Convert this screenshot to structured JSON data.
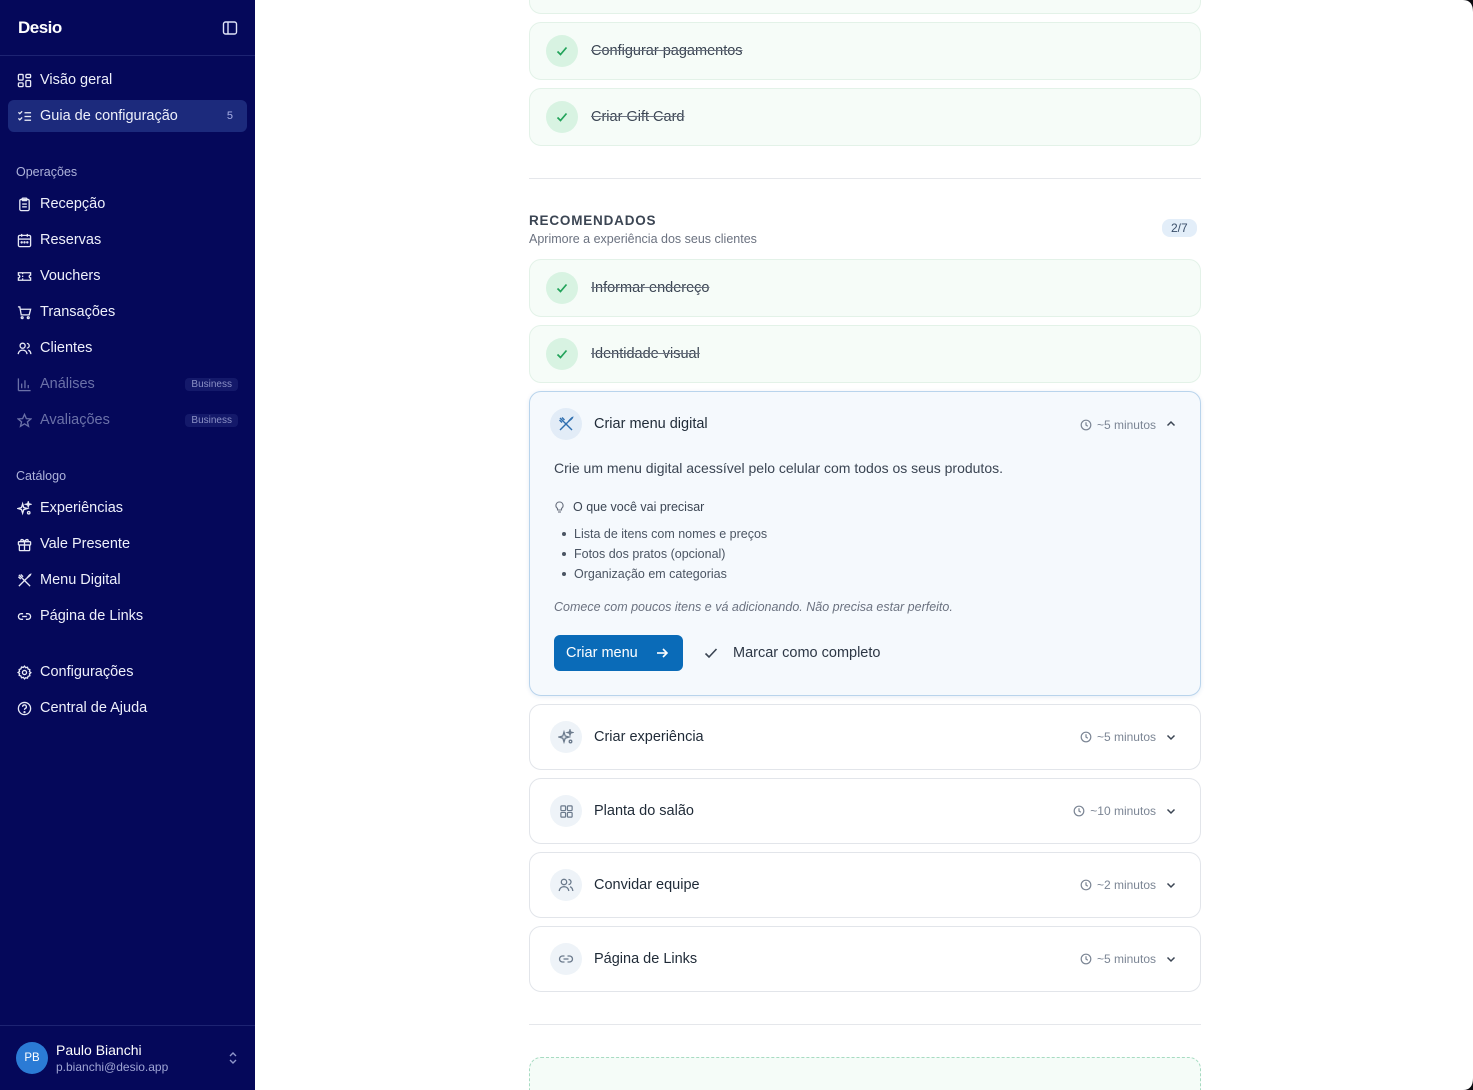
{
  "brand": {
    "name": "Desio"
  },
  "nav": {
    "overview": "Visão geral",
    "setup_guide": "Guia de configuração",
    "setup_guide_count": "5",
    "operations_label": "Operações",
    "reception": "Recepção",
    "reservations": "Reservas",
    "vouchers": "Vouchers",
    "transactions": "Transações",
    "clients": "Clientes",
    "analytics": "Análises",
    "analytics_badge": "Business",
    "reviews": "Avaliações",
    "reviews_badge": "Business",
    "catalog_label": "Catálogo",
    "experiences": "Experiências",
    "gift_card": "Vale Presente",
    "digital_menu": "Menu Digital",
    "links_page": "Página de Links",
    "settings": "Configurações",
    "help_center": "Central de Ajuda"
  },
  "user": {
    "initials": "PB",
    "name": "Paulo Bianchi",
    "email": "p.bianchi@desio.app"
  },
  "completed_top": [
    {
      "title": "Configurar pagamentos"
    },
    {
      "title": "Criar Gift Card"
    }
  ],
  "recommended": {
    "title": "RECOMENDADOS",
    "subtitle": "Aprimore a experiência dos seus clientes",
    "count": "2/7",
    "done": [
      {
        "title": "Informar endereço"
      },
      {
        "title": "Identidade visual"
      }
    ],
    "expanded": {
      "title": "Criar menu digital",
      "time": "~5 minutos",
      "description": "Crie um menu digital acessível pelo celular com todos os seus produtos.",
      "needs_title": "O que você vai precisar",
      "needs": [
        "Lista de itens com nomes e preços",
        "Fotos dos pratos (opcional)",
        "Organização em categorias"
      ],
      "tip": "Comece com poucos itens e vá adicionando. Não precisa estar perfeito.",
      "primary_label": "Criar menu",
      "mark_label": "Marcar como completo"
    },
    "pending": [
      {
        "title": "Criar experiência",
        "time": "~5 minutos",
        "icon": "sparkles-icon"
      },
      {
        "title": "Planta do salão",
        "time": "~10 minutos",
        "icon": "grid-icon"
      },
      {
        "title": "Convidar equipe",
        "time": "~2 minutos",
        "icon": "users-icon"
      },
      {
        "title": "Página de Links",
        "time": "~5 minutos",
        "icon": "link-icon"
      }
    ]
  },
  "colors": {
    "sidebar": "#05085a",
    "active_item": "#1c2a7c",
    "accent": "#0a6bb8",
    "success": "#22a35a",
    "done_card": "#f6fcf8"
  }
}
